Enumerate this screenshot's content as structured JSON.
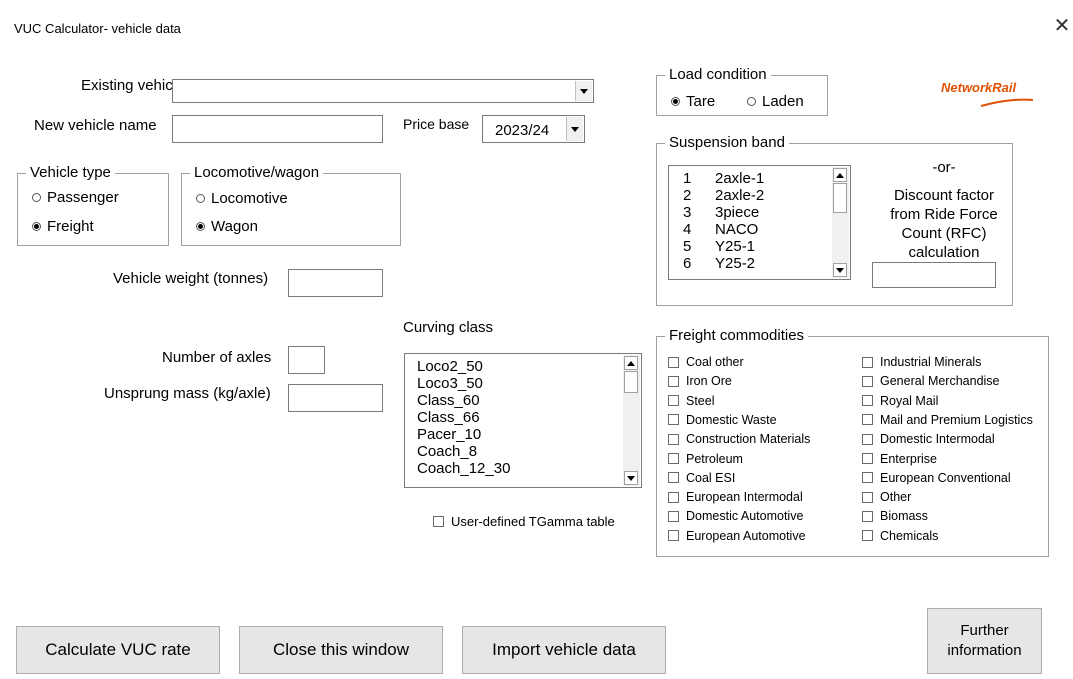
{
  "window": {
    "title": "VUC Calculator- vehicle data",
    "close_glyph": "✕"
  },
  "logo": {
    "text": "NetworkRail",
    "color": "#e05206"
  },
  "existing_vehicle": {
    "label": "Existing vehicle",
    "value": ""
  },
  "new_vehicle_name": {
    "label": "New vehicle name",
    "value": ""
  },
  "price_base": {
    "label": "Price base",
    "value": "2023/24"
  },
  "vehicle_type": {
    "title": "Vehicle type",
    "options": [
      {
        "label": "Passenger",
        "selected": false
      },
      {
        "label": "Freight",
        "selected": true
      }
    ]
  },
  "loco_wagon": {
    "title": "Locomotive/wagon",
    "options": [
      {
        "label": "Locomotive",
        "selected": false
      },
      {
        "label": "Wagon",
        "selected": true
      }
    ]
  },
  "vehicle_weight": {
    "label": "Vehicle weight (tonnes)",
    "value": ""
  },
  "number_of_axles": {
    "label": "Number of axles",
    "value": ""
  },
  "unsprung_mass": {
    "label": "Unsprung mass (kg/axle)",
    "value": ""
  },
  "curving_class": {
    "label": "Curving class",
    "items": [
      "Loco2_50",
      "Loco3_50",
      "Class_60",
      "Class_66",
      "Pacer_10",
      "Coach_8",
      "Coach_12_30"
    ]
  },
  "tgamma": {
    "label": "User-defined TGamma table",
    "checked": false
  },
  "load_condition": {
    "title": "Load condition",
    "options": [
      {
        "label": "Tare",
        "selected": true
      },
      {
        "label": "Laden",
        "selected": false
      }
    ]
  },
  "suspension_band": {
    "title": "Suspension band",
    "items": [
      {
        "n": "1",
        "name": "2axle-1"
      },
      {
        "n": "2",
        "name": "2axle-2"
      },
      {
        "n": "3",
        "name": "3piece"
      },
      {
        "n": "4",
        "name": "NACO"
      },
      {
        "n": "5",
        "name": "Y25-1"
      },
      {
        "n": "6",
        "name": "Y25-2"
      }
    ],
    "or_text": "-or-",
    "rfc_text": [
      "Discount factor",
      "from Ride Force",
      "Count (RFC)",
      "calculation"
    ],
    "rfc_value": ""
  },
  "freight_commodities": {
    "title": "Freight commodities",
    "left": [
      "Coal other",
      "Iron Ore",
      "Steel",
      "Domestic Waste",
      "Construction Materials",
      "Petroleum",
      "Coal ESI",
      "European Intermodal",
      "Domestic Automotive",
      "European Automotive"
    ],
    "right": [
      "Industrial Minerals",
      "General Merchandise",
      "Royal Mail",
      "Mail and Premium Logistics",
      "Domestic Intermodal",
      "Enterprise",
      "European Conventional",
      "Other",
      "Biomass",
      "Chemicals"
    ]
  },
  "buttons": {
    "calculate": "Calculate VUC rate",
    "close": "Close this window",
    "import": "Import vehicle data",
    "further": [
      "Further",
      "information"
    ]
  }
}
